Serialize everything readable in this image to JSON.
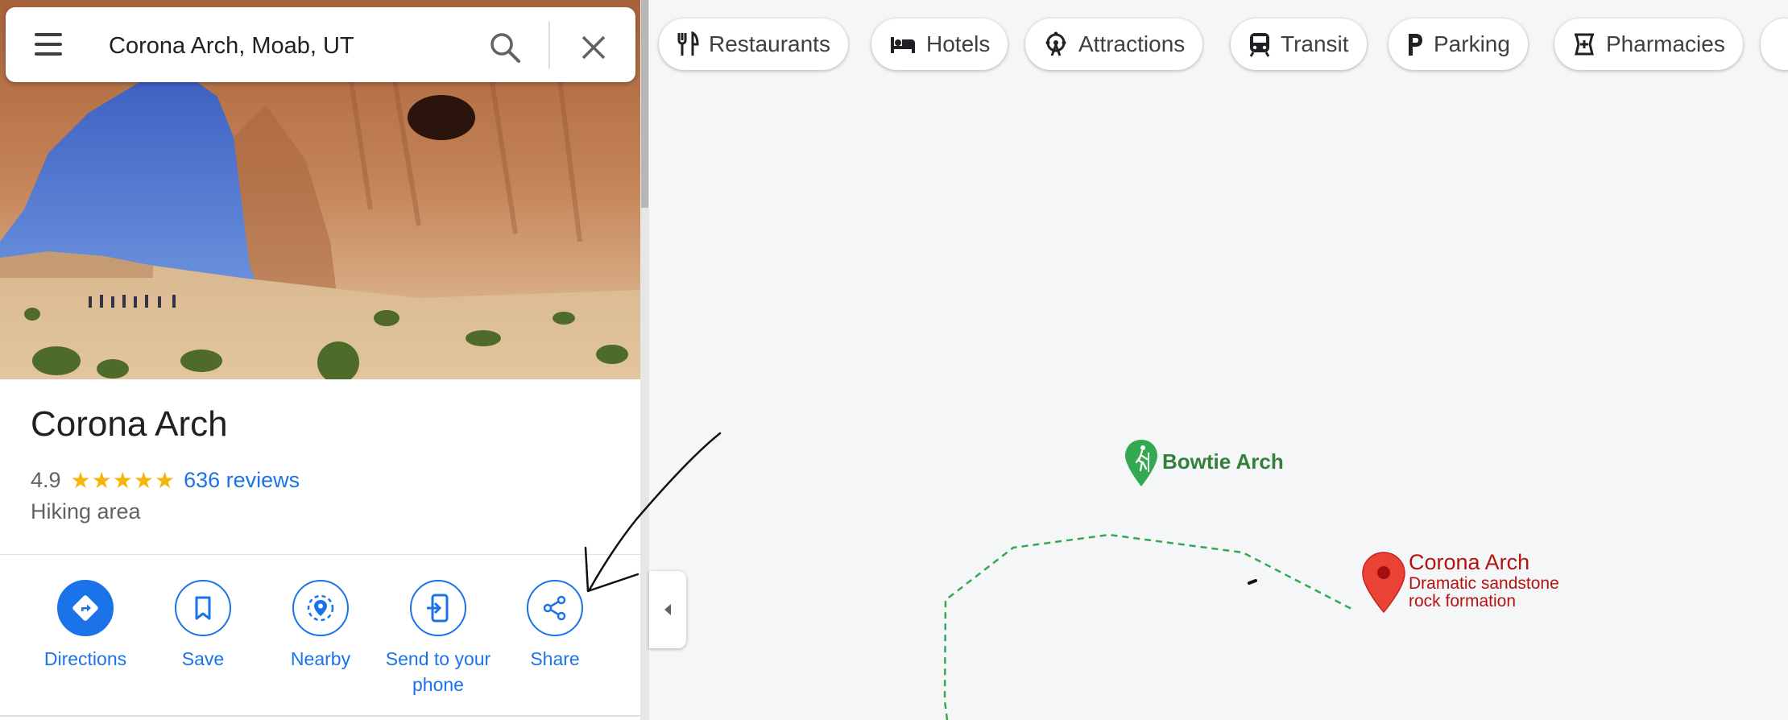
{
  "search": {
    "value": "Corona Arch, Moab, UT"
  },
  "place": {
    "name": "Corona Arch",
    "rating": "4.9",
    "stars": "★★★★★",
    "reviews": "636 reviews",
    "category": "Hiking area"
  },
  "actions": [
    {
      "label": "Directions"
    },
    {
      "label": "Save"
    },
    {
      "label": "Nearby"
    },
    {
      "label": "Send to your phone"
    },
    {
      "label": "Share"
    }
  ],
  "map": {
    "chips": [
      {
        "label": "Restaurants",
        "icon": "fork-knife-icon"
      },
      {
        "label": "Hotels",
        "icon": "bed-icon"
      },
      {
        "label": "Attractions",
        "icon": "ferris-wheel-icon"
      },
      {
        "label": "Transit",
        "icon": "train-icon"
      },
      {
        "label": "Parking",
        "icon": "parking-icon"
      },
      {
        "label": "Pharmacies",
        "icon": "pharmacy-icon"
      }
    ],
    "markers": {
      "bowtie": {
        "label": "Bowtie Arch"
      },
      "corona": {
        "label": "Corona Arch",
        "desc_line1": "Dramatic sandstone",
        "desc_line2": "rock formation"
      }
    }
  },
  "colors": {
    "accent": "#1a73e8",
    "pin_red": "#ea4335",
    "trail_green": "#34a853",
    "poi_green": "#34803a",
    "star_gold": "#f5b50a"
  }
}
